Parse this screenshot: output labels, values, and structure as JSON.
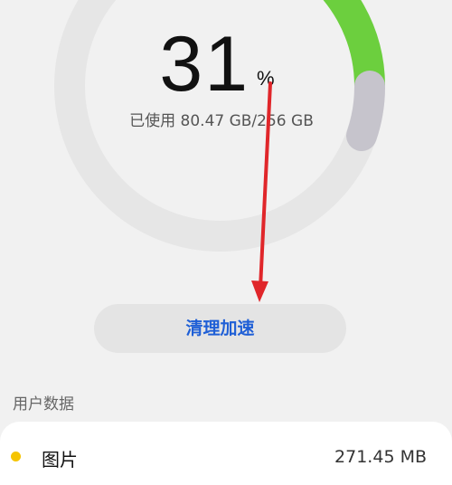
{
  "storage": {
    "percent_value": "31",
    "percent_unit": "%",
    "usage_text": "已使用 80.47 GB/256 GB",
    "used_fraction": 0.31
  },
  "colors": {
    "accent_green": "#6ccf3e",
    "track_gray": "#e6e6e6",
    "segment_gray": "#c6c4cc",
    "button_text_blue": "#1f5fd6",
    "arrow_red": "#e0262a"
  },
  "clean_button": {
    "label": "清理加速"
  },
  "user_data": {
    "section_label": "用户数据",
    "items": [
      {
        "label": "图片",
        "size": "271.45 MB",
        "color": "#f5c400"
      }
    ]
  }
}
